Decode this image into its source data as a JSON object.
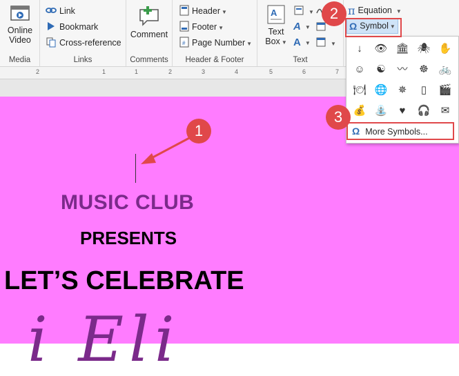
{
  "ribbon": {
    "media": {
      "button_line1": "Online",
      "button_line2": "Video",
      "label": "Media"
    },
    "links": {
      "items": [
        "Link",
        "Bookmark",
        "Cross-reference"
      ],
      "label": "Links"
    },
    "comments": {
      "button": "Comment",
      "label": "Comments"
    },
    "header_footer": {
      "items": [
        "Header",
        "Footer",
        "Page Number"
      ],
      "label": "Header & Footer"
    },
    "text": {
      "textbox_line1": "Text",
      "textbox_line2": "Box",
      "label": "Text"
    },
    "symbols": {
      "equation": "Equation",
      "symbol": "Symbol"
    }
  },
  "ruler": {
    "ticks": [
      "2",
      "1",
      "1",
      "2",
      "3",
      "4",
      "5",
      "6",
      "7"
    ]
  },
  "document": {
    "line1": "MUSIC CLUB",
    "line2": "PRESENTS",
    "line3": "LET’S CELEBRATE",
    "line4": "i  Eli"
  },
  "symbol_dropdown": {
    "symbols": [
      "↓",
      "👁",
      "🏛",
      "🕷",
      "✋",
      "☺",
      "☯",
      "〰",
      "☸",
      "🚲",
      "🍽",
      "🌐",
      "✵",
      "▯",
      "🎬",
      "💰",
      "⛲",
      "♥",
      "🎧",
      "✉"
    ],
    "more_label": "More Symbols..."
  },
  "callouts": [
    "1",
    "2",
    "3"
  ],
  "colors": {
    "page_bg": "#ff7cff",
    "title_purple": "#7b2a8a",
    "callout_red": "#e0484a"
  }
}
